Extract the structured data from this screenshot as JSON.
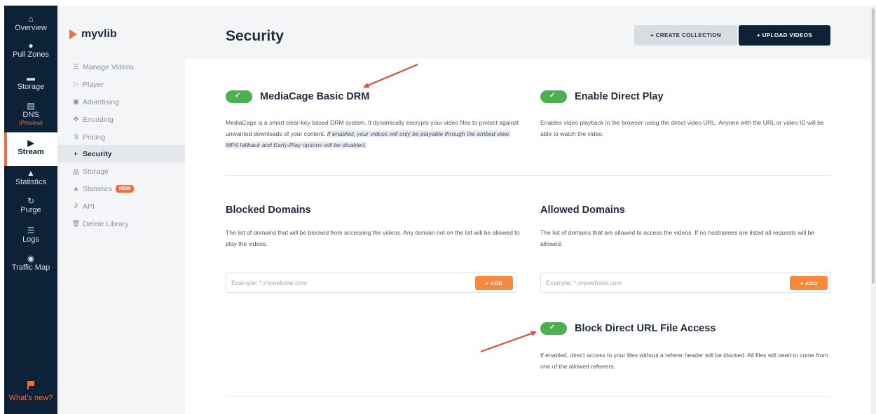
{
  "rail": {
    "items": [
      {
        "label": "Overview",
        "icon": "home-icon",
        "glyph": "⌂"
      },
      {
        "label": "Pull Zones",
        "icon": "location-pin-icon",
        "glyph": "●"
      },
      {
        "label": "Storage",
        "icon": "drive-icon",
        "glyph": "▬"
      },
      {
        "label": "DNS",
        "sub": "(Preview)",
        "icon": "server-icon",
        "glyph": "▤"
      },
      {
        "label": "Stream",
        "icon": "play-icon",
        "glyph": "▶"
      },
      {
        "label": "Statistics",
        "icon": "chart-icon",
        "glyph": "▲"
      },
      {
        "label": "Purge",
        "icon": "refresh-icon",
        "glyph": "↻"
      },
      {
        "label": "Logs",
        "icon": "list-icon",
        "glyph": "☰"
      },
      {
        "label": "Traffic Map",
        "icon": "map-pin-icon",
        "glyph": "◉"
      }
    ],
    "whats_new": "What's new?"
  },
  "library": {
    "name": "myvlib",
    "nav": [
      {
        "label": "Manage Videos",
        "icon": "list-icon",
        "glyph": "☰"
      },
      {
        "label": "Player",
        "icon": "play-outline-icon",
        "glyph": "▷"
      },
      {
        "label": "Advertising",
        "icon": "ad-icon",
        "glyph": "▣"
      },
      {
        "label": "Encoding",
        "icon": "gears-icon",
        "glyph": "✥"
      },
      {
        "label": "Pricing",
        "icon": "coin-icon",
        "glyph": "$"
      },
      {
        "label": "Security",
        "icon": "shield-icon",
        "glyph": "◐"
      },
      {
        "label": "Storage",
        "icon": "sitemap-icon",
        "glyph": "品"
      },
      {
        "label": "Statistics",
        "icon": "chart-icon",
        "glyph": "▲",
        "badge": "NEW"
      },
      {
        "label": "API",
        "icon": "link-icon",
        "glyph": "∂"
      },
      {
        "label": "Delete Library",
        "icon": "trash-icon",
        "glyph": "🗑"
      }
    ]
  },
  "header": {
    "title": "Security",
    "create_collection": "+ CREATE COLLECTION",
    "upload_videos": "+ UPLOAD VIDEOS"
  },
  "sections": {
    "drm": {
      "enabled": true,
      "title": "MediaCage Basic DRM",
      "desc_plain": "MediaCage is a smart clear-key based DRM system. It dynamically encrypts your video files to protect against unwanted downloads of your content. ",
      "desc_italic": "If enabled, your videos will only be playable through the embed view. MP4 fallback and Early-Play options will be disabled."
    },
    "direct_play": {
      "enabled": true,
      "title": "Enable Direct Play",
      "desc": "Enables video playback in the browser using the direct video URL. Anyone with the URL or video ID will be able to watch the video."
    },
    "blocked_domains": {
      "title": "Blocked Domains",
      "desc": "The list of domains that will be blocked from accessing the videos. Any domain not on the list will be allowed to play the videos.",
      "placeholder": "Example: *.mywebsite.com",
      "add_label": "+ ADD"
    },
    "allowed_domains": {
      "title": "Allowed Domains",
      "desc": "The list of domains that are allowed to access the videos. If no hostnames are listed all requests will be allowed.",
      "placeholder": "Example: *.mywebsite.com",
      "add_label": "+ ADD"
    },
    "block_direct_url": {
      "enabled": true,
      "title": "Block Direct URL File Access",
      "desc": "If enabled, direct access to your files without a referer header will be blocked. All files will need to come from one of the allowed referrers."
    }
  },
  "colors": {
    "rail_bg": "#0e2237",
    "accent": "#f26d3d",
    "toggle_on": "#4caf50",
    "add_button": "#f7893f",
    "annotation_arrow": "#e04a3c"
  }
}
